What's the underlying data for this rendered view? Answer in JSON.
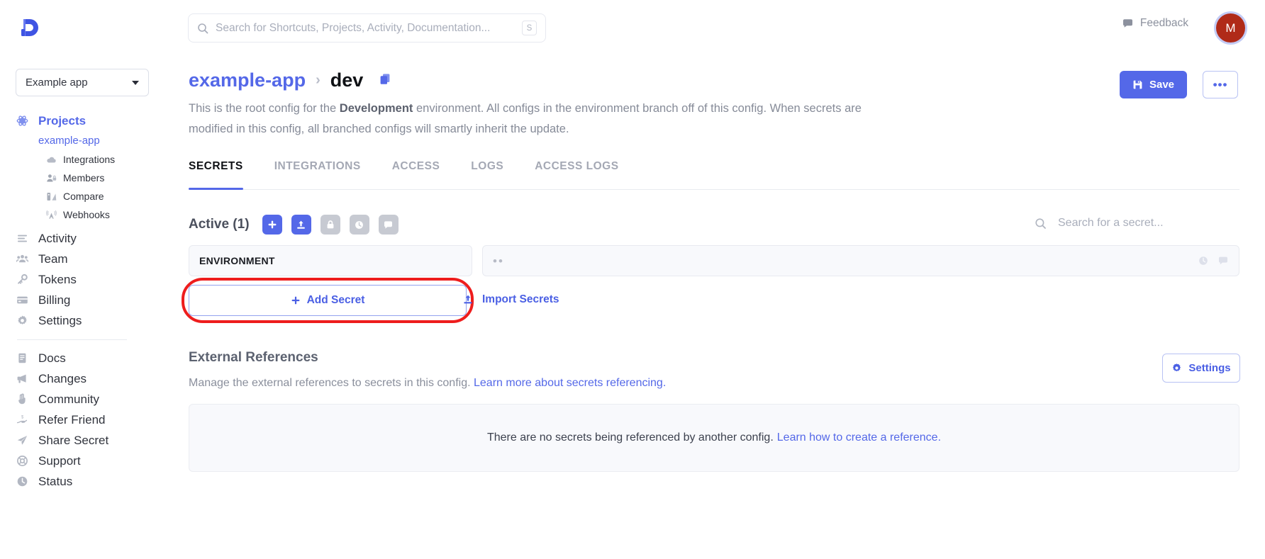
{
  "topbar": {
    "logo_name": "doppler-logo",
    "search_placeholder": "Search for Shortcuts, Projects, Activity, Documentation...",
    "search_value": "",
    "search_shortcut_key": "S",
    "feedback_label": "Feedback",
    "avatar_initial": "M"
  },
  "sidebar": {
    "workspace_label": "Example app",
    "projects_label": "Projects",
    "project_name": "example-app",
    "project_children": [
      {
        "label": "Integrations",
        "icon": "cloud-icon"
      },
      {
        "label": "Members",
        "icon": "members-icon"
      },
      {
        "label": "Compare",
        "icon": "compare-icon"
      },
      {
        "label": "Webhooks",
        "icon": "webhooks-icon"
      }
    ],
    "main_items": [
      {
        "label": "Activity",
        "icon": "activity-icon"
      },
      {
        "label": "Team",
        "icon": "team-icon"
      },
      {
        "label": "Tokens",
        "icon": "key-icon"
      },
      {
        "label": "Billing",
        "icon": "card-icon"
      },
      {
        "label": "Settings",
        "icon": "gear-icon"
      }
    ],
    "secondary_items": [
      {
        "label": "Docs",
        "icon": "book-icon"
      },
      {
        "label": "Changes",
        "icon": "megaphone-icon"
      },
      {
        "label": "Community",
        "icon": "hand-icon"
      },
      {
        "label": "Refer Friend",
        "icon": "refer-icon"
      },
      {
        "label": "Share Secret",
        "icon": "paper-plane-icon"
      },
      {
        "label": "Support",
        "icon": "lifebuoy-icon"
      },
      {
        "label": "Status",
        "icon": "clock-icon"
      }
    ]
  },
  "header": {
    "breadcrumb_project": "example-app",
    "breadcrumb_separator": "›",
    "breadcrumb_config": "dev",
    "copy_icon": "copy-icon",
    "description_pre": "This is the root config for the ",
    "description_bold": "Development",
    "description_post": " environment. All configs in the environment branch off of this config. When secrets are modified in this config, all branched configs will smartly inherit the update.",
    "save_label": "Save",
    "more_label": "•••"
  },
  "tabs": [
    {
      "label": "SECRETS",
      "active": true
    },
    {
      "label": "INTEGRATIONS",
      "active": false
    },
    {
      "label": "ACCESS",
      "active": false
    },
    {
      "label": "LOGS",
      "active": false
    },
    {
      "label": "ACCESS LOGS",
      "active": false
    }
  ],
  "secrets": {
    "active_label": "Active (1)",
    "toolbar": [
      {
        "name": "add-secret-icon-button",
        "icon": "plus-icon",
        "style": "blue"
      },
      {
        "name": "import-secrets-icon-button",
        "icon": "upload-icon",
        "style": "blue"
      },
      {
        "name": "lock-icon-button",
        "icon": "lock-icon",
        "style": "grey"
      },
      {
        "name": "history-icon-button",
        "icon": "clock-icon",
        "style": "grey"
      },
      {
        "name": "notes-icon-button",
        "icon": "comment-icon",
        "style": "grey"
      }
    ],
    "search_placeholder": "Search for a secret...",
    "search_value": "",
    "rows": [
      {
        "key": "ENVIRONMENT",
        "value_masked": "••"
      }
    ],
    "add_secret_label": "Add Secret",
    "import_secrets_label": "Import Secrets",
    "highlight_color": "#ee1d1d"
  },
  "external_references": {
    "title": "External References",
    "subtitle_text": "Manage the external references to secrets in this config.",
    "subtitle_link": "Learn more about secrets referencing.",
    "settings_label": "Settings",
    "empty_text": "There are no secrets being referenced by another config.",
    "empty_link": "Learn how to create a reference."
  },
  "colors": {
    "accent": "#5468e8",
    "grey_icon": "#c7cad2",
    "panel_bg": "#f8f9fc",
    "avatar_bg": "#b02a18"
  }
}
